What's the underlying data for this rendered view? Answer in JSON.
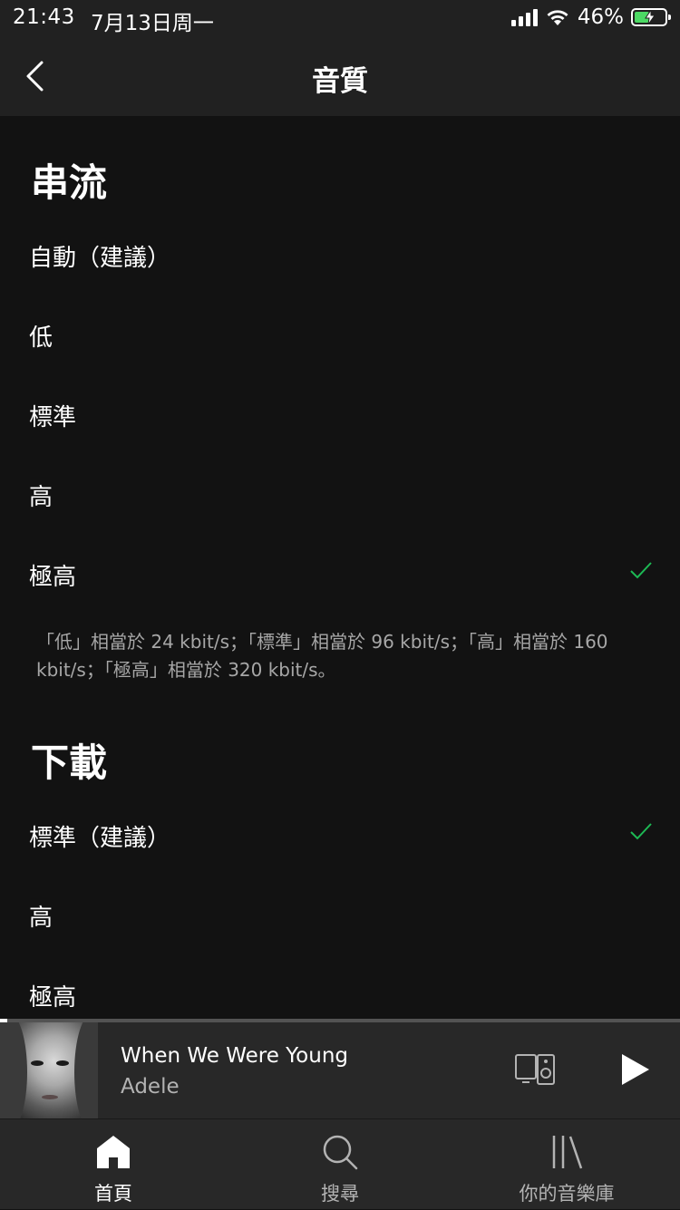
{
  "status_bar": {
    "time": "21:43",
    "date": "7月13日周一",
    "battery_percent": "46%",
    "battery_level": 0.46,
    "icons": [
      "signal-icon",
      "wifi-icon",
      "battery-charging-icon"
    ]
  },
  "nav": {
    "title": "音質",
    "back_icon": "chevron-left-icon"
  },
  "streaming": {
    "heading": "串流",
    "options": [
      {
        "label": "自動（建議）",
        "selected": false
      },
      {
        "label": "低",
        "selected": false
      },
      {
        "label": "標準",
        "selected": false
      },
      {
        "label": "高",
        "selected": false
      },
      {
        "label": "極高",
        "selected": true
      }
    ],
    "note": "「低」相當於 24 kbit/s；「標準」相當於 96 kbit/s；「高」相當於 160 kbit/s；「極高」相當於 320 kbit/s。"
  },
  "download": {
    "heading": "下載",
    "options": [
      {
        "label": "標準（建議）",
        "selected": true
      },
      {
        "label": "高",
        "selected": false
      },
      {
        "label": "極高",
        "selected": false
      }
    ]
  },
  "now_playing": {
    "title": "When We Were Young",
    "artist": "Adele",
    "progress": 0.01,
    "icons": [
      "devices-icon",
      "play-icon"
    ]
  },
  "tabs": [
    {
      "label": "首頁",
      "icon": "home-icon",
      "active": true
    },
    {
      "label": "搜尋",
      "icon": "search-icon",
      "active": false
    },
    {
      "label": "你的音樂庫",
      "icon": "library-icon",
      "active": false
    }
  ],
  "colors": {
    "background": "#121212",
    "header": "#212121",
    "player": "#282828",
    "accent_green": "#1db954",
    "secondary_text": "#a7a7a7"
  }
}
